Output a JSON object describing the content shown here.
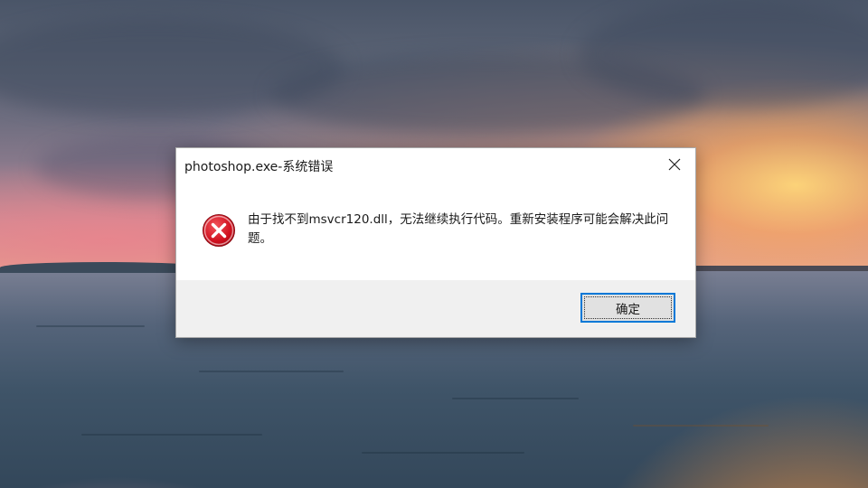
{
  "dialog": {
    "title": "photoshop.exe-系统错误",
    "message": "由于找不到msvcr120.dll，无法继续执行代码。重新安装程序可能会解决此问题。",
    "ok_label": "确定",
    "close_icon": "close-icon",
    "status_icon": "error-icon"
  },
  "colors": {
    "error_red": "#e81123",
    "focus_blue": "#0078d7",
    "footer_bg": "#f0f0f0"
  }
}
